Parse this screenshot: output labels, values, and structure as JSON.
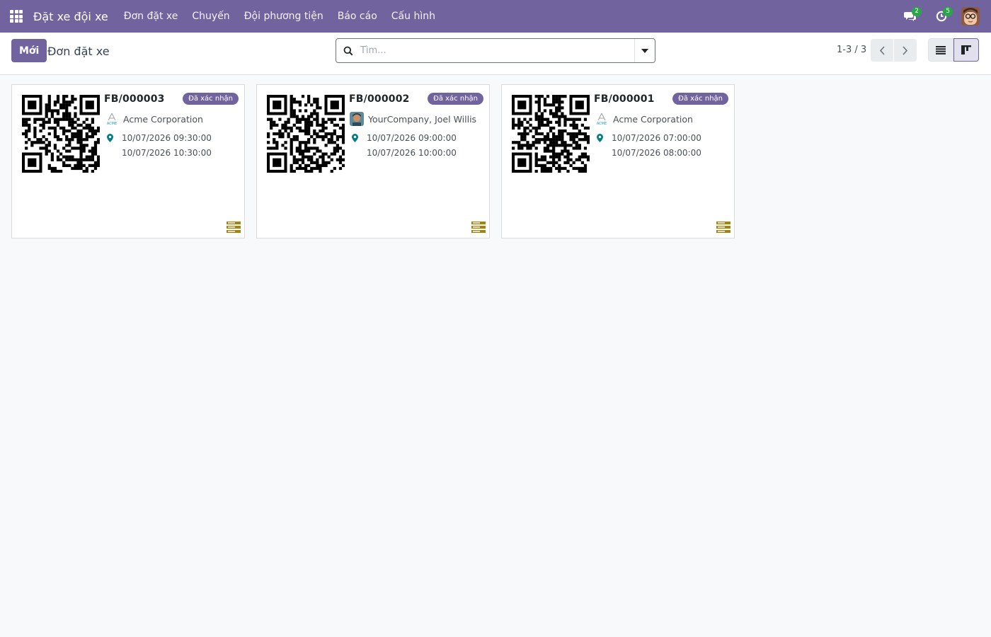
{
  "navbar": {
    "app_title": "Đặt xe đội xe",
    "menu": [
      "Đơn đặt xe",
      "Chuyến",
      "Đội phương tiện",
      "Báo cáo",
      "Cấu hình"
    ],
    "messages_count": "2",
    "activities_count": "5"
  },
  "control_panel": {
    "new_button": "Mới",
    "breadcrumb": "Đơn đặt xe",
    "search_placeholder": "Tìm...",
    "pager": "1-3 / 3"
  },
  "cards": [
    {
      "reference": "FB/000003",
      "status": "Đã xác nhận",
      "partner": "Acme Corporation",
      "partner_logo_text": "ACME",
      "start": "10/07/2026 09:30:00",
      "end": "10/07/2026 10:30:00"
    },
    {
      "reference": "FB/000002",
      "status": "Đã xác nhận",
      "partner": "YourCompany, Joel Willis",
      "start": "10/07/2026 09:00:00",
      "end": "10/07/2026 10:00:00"
    },
    {
      "reference": "FB/000001",
      "status": "Đã xác nhận",
      "partner": "Acme Corporation",
      "partner_logo_text": "ACME",
      "start": "10/07/2026 07:00:00",
      "end": "10/07/2026 08:00:00"
    }
  ],
  "colors": {
    "brand": "#71639e",
    "badge": "#71639e",
    "systray_badge": "#28a745",
    "pin": "#017e84",
    "stack_icon": "#a5830f"
  }
}
